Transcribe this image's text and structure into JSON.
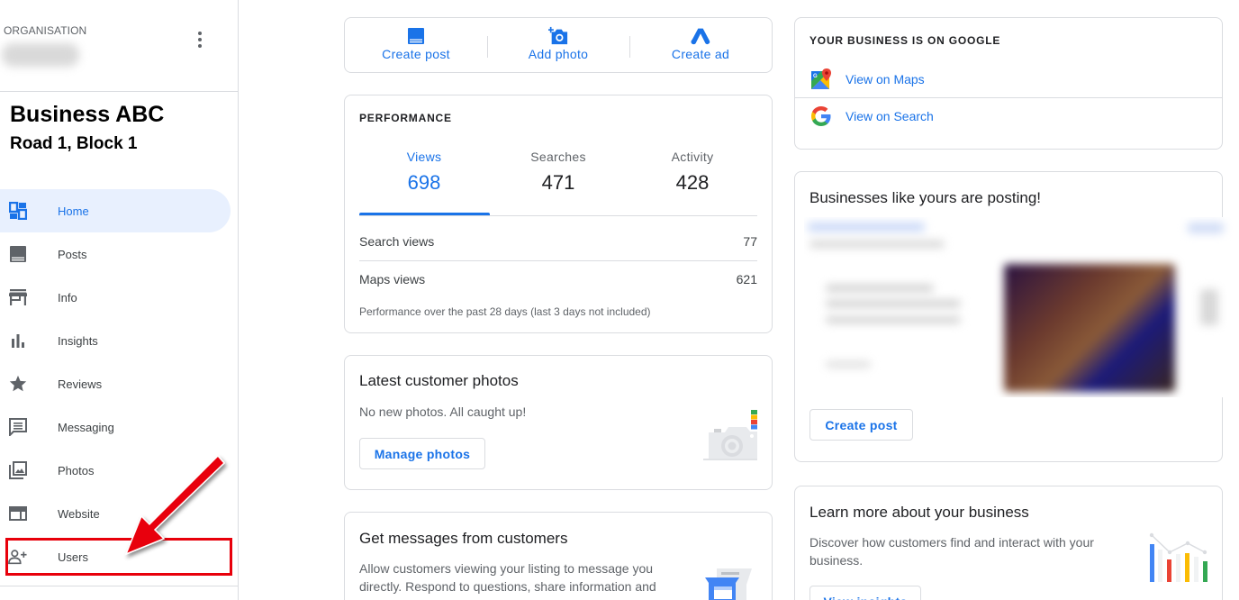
{
  "sidebar": {
    "org_label": "ORGANISATION",
    "business_name": "Business ABC",
    "business_address": "Road 1, Block 1",
    "items": [
      {
        "label": "Home",
        "icon": "dashboard-icon",
        "active": true
      },
      {
        "label": "Posts",
        "icon": "posts-icon"
      },
      {
        "label": "Info",
        "icon": "storefront-icon"
      },
      {
        "label": "Insights",
        "icon": "bar-chart-icon"
      },
      {
        "label": "Reviews",
        "icon": "star-icon"
      },
      {
        "label": "Messaging",
        "icon": "message-icon"
      },
      {
        "label": "Photos",
        "icon": "photo-library-icon"
      },
      {
        "label": "Website",
        "icon": "website-icon"
      },
      {
        "label": "Users",
        "icon": "person-add-icon",
        "highlighted": true
      }
    ]
  },
  "quick_actions": [
    {
      "label": "Create post",
      "icon": "post-icon"
    },
    {
      "label": "Add photo",
      "icon": "add-photo-icon"
    },
    {
      "label": "Create ad",
      "icon": "google-ads-icon"
    }
  ],
  "performance": {
    "title": "PERFORMANCE",
    "tabs": [
      {
        "label": "Views",
        "value": "698",
        "active": true
      },
      {
        "label": "Searches",
        "value": "471"
      },
      {
        "label": "Activity",
        "value": "428"
      }
    ],
    "rows": [
      {
        "label": "Search views",
        "value": "77"
      },
      {
        "label": "Maps views",
        "value": "621"
      }
    ],
    "footnote": "Performance over the past 28 days (last 3 days not included)"
  },
  "photos_card": {
    "title": "Latest customer photos",
    "text": "No new photos. All caught up!",
    "button": "Manage photos"
  },
  "messages_card": {
    "title": "Get messages from customers",
    "text": "Allow customers viewing your listing to message you directly. Respond to questions, share information and"
  },
  "google_card": {
    "title": "YOUR BUSINESS IS ON GOOGLE",
    "links": [
      {
        "label": "View on Maps",
        "icon": "google-maps-icon"
      },
      {
        "label": "View on Search",
        "icon": "google-g-icon"
      }
    ]
  },
  "posting_card": {
    "title": "Businesses like yours are posting!",
    "button": "Create post"
  },
  "insights_card": {
    "title": "Learn more about your business",
    "text": "Discover how customers find and interact with your business.",
    "button": "View insights"
  },
  "colors": {
    "accent": "#1a73e8",
    "active_bg": "#e8f0fe",
    "annotation": "#e8000b"
  }
}
